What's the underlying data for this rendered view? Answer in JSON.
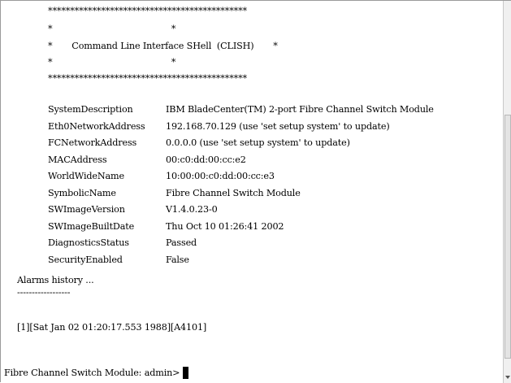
{
  "banner": {
    "top_border": "*********************************************",
    "blank_line": "*                                           *",
    "title_line": "*       Command Line Interface SHell  (CLISH)       *",
    "bottom_border": "*********************************************"
  },
  "system_info": [
    {
      "key": "SystemDescription",
      "value": "IBM BladeCenter(TM) 2-port Fibre Channel Switch Module"
    },
    {
      "key": "Eth0NetworkAddress",
      "value": "192.168.70.129 (use 'set setup system' to update)"
    },
    {
      "key": "FCNetworkAddress",
      "value": "0.0.0.0 (use 'set setup system' to update)"
    },
    {
      "key": "MACAddress",
      "value": "00:c0:dd:00:cc:e2"
    },
    {
      "key": "WorldWideName",
      "value": "10:00:00:c0:dd:00:cc:e3"
    },
    {
      "key": "SymbolicName",
      "value": "Fibre Channel Switch Module"
    },
    {
      "key": "SWImageVersion",
      "value": "V1.4.0.23-0"
    },
    {
      "key": "SWImageBuiltDate",
      "value": "Thu Oct 10 01:26:41 2002"
    },
    {
      "key": "DiagnosticsStatus",
      "value": "Passed"
    },
    {
      "key": "SecurityEnabled",
      "value": "False"
    }
  ],
  "alarms": {
    "heading": "Alarms history ...",
    "underline": "------------------",
    "entry": "[1][Sat Jan 02 01:20:17.553 1988][A4101]"
  },
  "prompt": {
    "text": "Fibre Channel Switch Module: admin>"
  }
}
